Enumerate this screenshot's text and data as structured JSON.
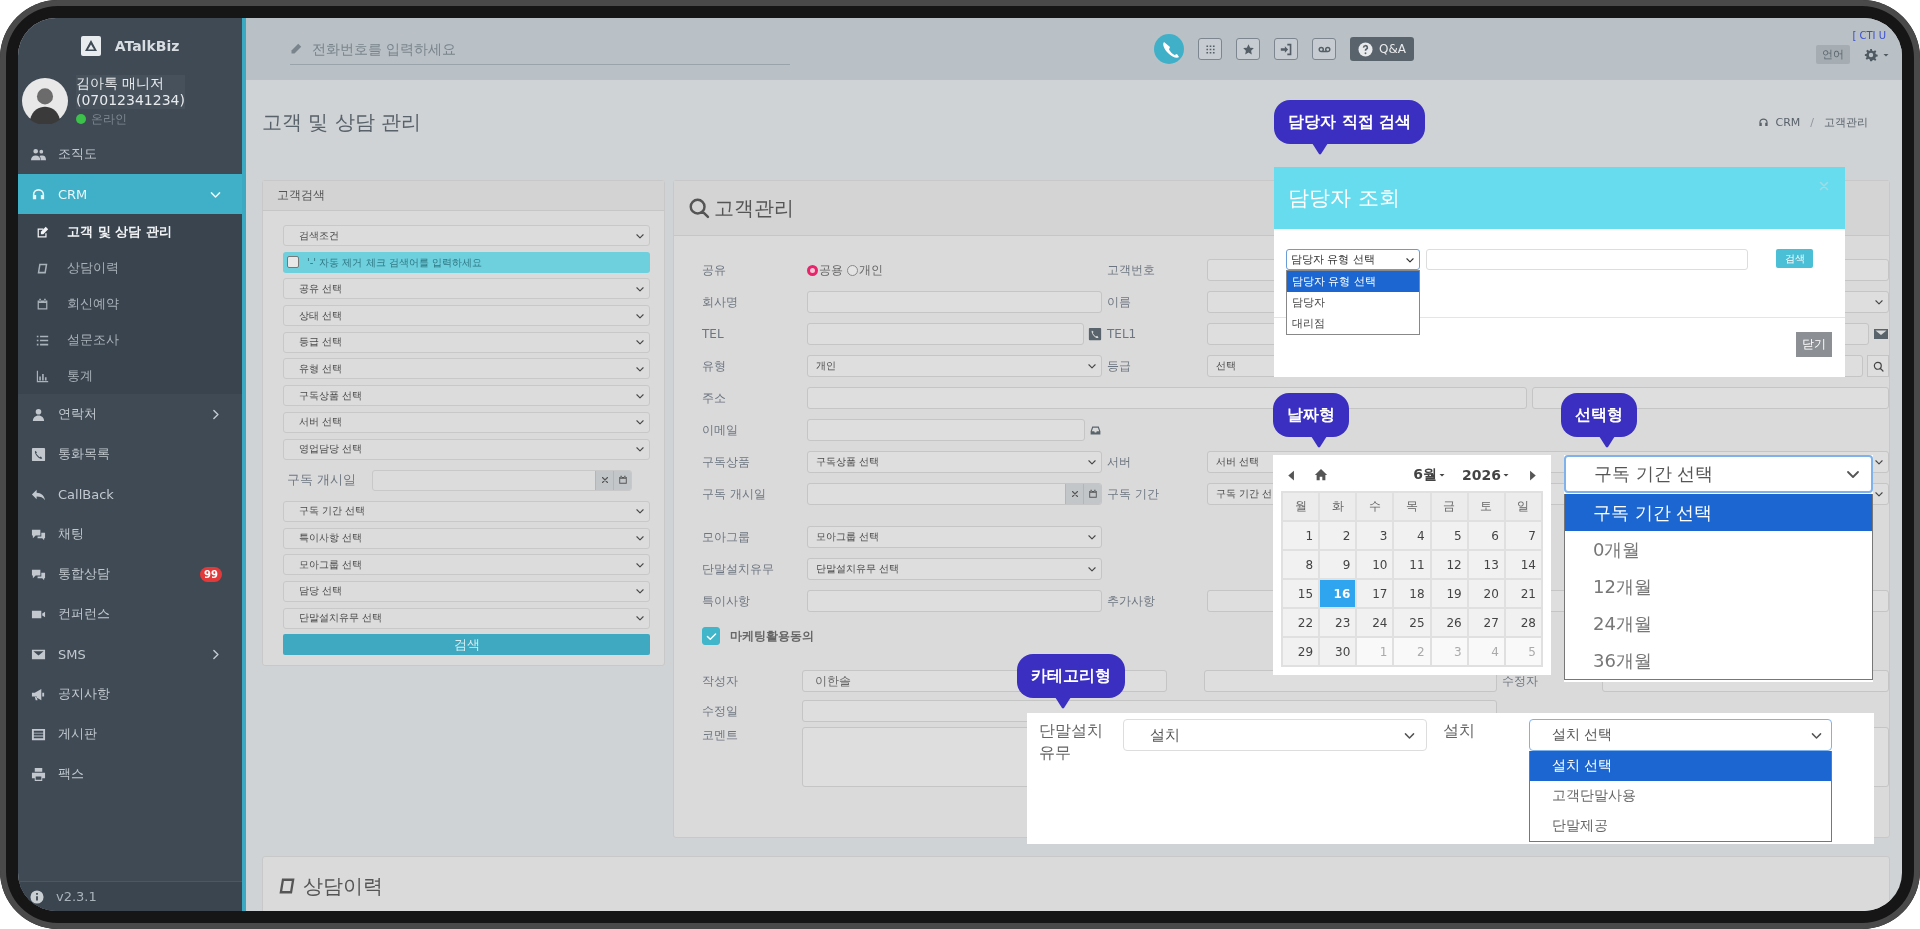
{
  "sidebar": {
    "logo": "ATalkBiz",
    "user": {
      "name": "김아톡 매니저",
      "phone": "(07012341234)",
      "status": "온라인",
      "online": true
    },
    "items": [
      {
        "label": "조직도",
        "selected": false
      },
      {
        "label": "CRM",
        "selected": true,
        "expanded": true,
        "children": [
          {
            "label": "고객 및 상담 관리",
            "selected": true
          },
          {
            "label": "상담이력",
            "selected": false
          },
          {
            "label": "회신예약",
            "selected": false
          },
          {
            "label": "설문조사",
            "selected": false
          },
          {
            "label": "통계",
            "selected": false
          }
        ]
      },
      {
        "label": "연락처",
        "selected": false,
        "expanded": false
      },
      {
        "label": "통화목록",
        "selected": false
      },
      {
        "label": "CallBack",
        "selected": false
      },
      {
        "label": "채팅",
        "selected": false
      },
      {
        "label": "통합상담",
        "selected": false,
        "badge": "99"
      },
      {
        "label": "컨퍼런스",
        "selected": false
      },
      {
        "label": "SMS",
        "selected": false,
        "expanded": false
      },
      {
        "label": "공지사항",
        "selected": false
      },
      {
        "label": "게시판",
        "selected": false
      },
      {
        "label": "팩스",
        "selected": false
      }
    ],
    "version": "v2.3.1"
  },
  "topbar": {
    "phone_input": {
      "placeholder": "전화번호를 입력하세요"
    },
    "qa_button": "Q&A",
    "language_button": "언어",
    "cti_status": "[ CTI U"
  },
  "page": {
    "title": "고객 및 상담 관리",
    "breadcrumb": [
      "CRM",
      "고객관리"
    ],
    "breadcrumb_separator": "/"
  },
  "search_panel": {
    "title": "고객검색",
    "filters": [
      {
        "kind": "select",
        "value": "검색조건"
      },
      {
        "kind": "keyword",
        "placeholder": "'-' 자동 제거 체크 검색어를 입력하세요",
        "checked": false
      },
      {
        "kind": "select",
        "value": "공유 선택"
      },
      {
        "kind": "select",
        "value": "상태 선택"
      },
      {
        "kind": "select",
        "value": "등급 선택"
      },
      {
        "kind": "select",
        "value": "유형 선택"
      },
      {
        "kind": "select",
        "value": "구독상품 선택"
      },
      {
        "kind": "select",
        "value": "서버 선택"
      },
      {
        "kind": "select",
        "value": "영업담당 선택"
      },
      {
        "kind": "date",
        "label": "구독 개시일"
      },
      {
        "kind": "select",
        "value": "구독 기간 선택"
      },
      {
        "kind": "select",
        "value": "특이사항 선택"
      },
      {
        "kind": "select",
        "value": "모아그룹 선택"
      },
      {
        "kind": "select",
        "value": "담당 선택"
      },
      {
        "kind": "select",
        "value": "단말설치유무 선택"
      }
    ],
    "search_button": "검색"
  },
  "customer_panel": {
    "title": "고객관리",
    "rows": [
      {
        "label": "공유",
        "kind": "radio",
        "options": [
          {
            "label": "공용",
            "selected": true
          },
          {
            "label": "개인",
            "selected": false
          }
        ],
        "right": {
          "label": "고객번호",
          "kind": "input"
        }
      },
      {
        "label": "회사명",
        "kind": "input",
        "right": {
          "label": "이름",
          "kind": "select"
        }
      },
      {
        "label": "TEL",
        "kind": "phone",
        "right": {
          "label": "TEL1",
          "kind": "contact"
        }
      },
      {
        "label": "유형",
        "kind": "select",
        "value": "개인",
        "right": {
          "label": "등급",
          "kind": "lookup",
          "value": "선택"
        }
      },
      {
        "label": "주소",
        "kind": "address"
      },
      {
        "label": "이메일",
        "kind": "email"
      },
      {
        "label": "구독상품",
        "kind": "select",
        "value": "구독상품 선택",
        "right": {
          "label": "서버",
          "kind": "select",
          "value": "서버 선택"
        }
      },
      {
        "label": "구독 개시일",
        "kind": "date",
        "right": {
          "label": "구독 기간",
          "kind": "select",
          "value": "구독 기간 선"
        }
      },
      {
        "label": "모아그룹",
        "kind": "select",
        "value": "모아그룹 선택"
      },
      {
        "label": "단말설치유무",
        "kind": "select",
        "value": "단말설치유무 선택"
      },
      {
        "label": "특이사항",
        "kind": "input",
        "right": {
          "label": "추가사항",
          "kind": "input"
        }
      }
    ],
    "marketing_consent": {
      "label": "마케팅활용동의",
      "checked": true
    },
    "author_label": "작성자",
    "author": "이한솔",
    "modifier_label": "수정자",
    "modified_label": "수정일",
    "comment_label": "코멘트"
  },
  "history_panel": {
    "title": "상담이력"
  },
  "manager_lookup": {
    "callout": "담당자 직접 검색",
    "title": "담당자 조회",
    "type_select": {
      "value": "담당자 유형 선택",
      "options": [
        {
          "label": "담당자 유형 선택",
          "selected": true
        },
        {
          "label": "담당자",
          "selected": false
        },
        {
          "label": "대리점",
          "selected": false
        }
      ]
    },
    "search_button": "검색",
    "close_button": "닫기"
  },
  "date_example": {
    "callout": "날짜형",
    "month": "6월",
    "year": "2026",
    "weekdays": [
      "월",
      "화",
      "수",
      "목",
      "금",
      "토",
      "일"
    ],
    "weeks": [
      [
        {
          "day": "1",
          "selected": false,
          "other_month": false
        },
        {
          "day": "2",
          "selected": false,
          "other_month": false
        },
        {
          "day": "3",
          "selected": false,
          "other_month": false
        },
        {
          "day": "4",
          "selected": false,
          "other_month": false
        },
        {
          "day": "5",
          "selected": false,
          "other_month": false
        },
        {
          "day": "6",
          "selected": false,
          "other_month": false
        },
        {
          "day": "7",
          "selected": false,
          "other_month": false
        }
      ],
      [
        {
          "day": "8",
          "selected": false,
          "other_month": false
        },
        {
          "day": "9",
          "selected": false,
          "other_month": false
        },
        {
          "day": "10",
          "selected": false,
          "other_month": false
        },
        {
          "day": "11",
          "selected": false,
          "other_month": false
        },
        {
          "day": "12",
          "selected": false,
          "other_month": false
        },
        {
          "day": "13",
          "selected": false,
          "other_month": false
        },
        {
          "day": "14",
          "selected": false,
          "other_month": false
        }
      ],
      [
        {
          "day": "15",
          "selected": false,
          "other_month": false
        },
        {
          "day": "16",
          "selected": true,
          "other_month": false
        },
        {
          "day": "17",
          "selected": false,
          "other_month": false
        },
        {
          "day": "18",
          "selected": false,
          "other_month": false
        },
        {
          "day": "19",
          "selected": false,
          "other_month": false
        },
        {
          "day": "20",
          "selected": false,
          "other_month": false
        },
        {
          "day": "21",
          "selected": false,
          "other_month": false
        }
      ],
      [
        {
          "day": "22",
          "selected": false,
          "other_month": false
        },
        {
          "day": "23",
          "selected": false,
          "other_month": false
        },
        {
          "day": "24",
          "selected": false,
          "other_month": false
        },
        {
          "day": "25",
          "selected": false,
          "other_month": false
        },
        {
          "day": "26",
          "selected": false,
          "other_month": false
        },
        {
          "day": "27",
          "selected": false,
          "other_month": false
        },
        {
          "day": "28",
          "selected": false,
          "other_month": false
        }
      ],
      [
        {
          "day": "29",
          "selected": false,
          "other_month": false
        },
        {
          "day": "30",
          "selected": false,
          "other_month": false
        },
        {
          "day": "1",
          "selected": false,
          "other_month": true
        },
        {
          "day": "2",
          "selected": false,
          "other_month": true
        },
        {
          "day": "3",
          "selected": false,
          "other_month": true
        },
        {
          "day": "4",
          "selected": false,
          "other_month": true
        },
        {
          "day": "5",
          "selected": false,
          "other_month": true
        }
      ]
    ]
  },
  "select_example": {
    "callout": "선택형",
    "value": "구독 기간 선택",
    "options": [
      {
        "label": "구독 기간 선택",
        "selected": true
      },
      {
        "label": "0개월",
        "selected": false
      },
      {
        "label": "12개월",
        "selected": false
      },
      {
        "label": "24개월",
        "selected": false
      },
      {
        "label": "36개월",
        "selected": false
      }
    ]
  },
  "category_example": {
    "callout": "카테고리형",
    "label": "단말설치유무",
    "value": "설치",
    "sub_label": "설치",
    "sub_select": {
      "value": "설치 선택",
      "options": [
        {
          "label": "설치 선택",
          "selected": true
        },
        {
          "label": "고객단말사용",
          "selected": false
        },
        {
          "label": "단말제공",
          "selected": false
        }
      ]
    }
  }
}
